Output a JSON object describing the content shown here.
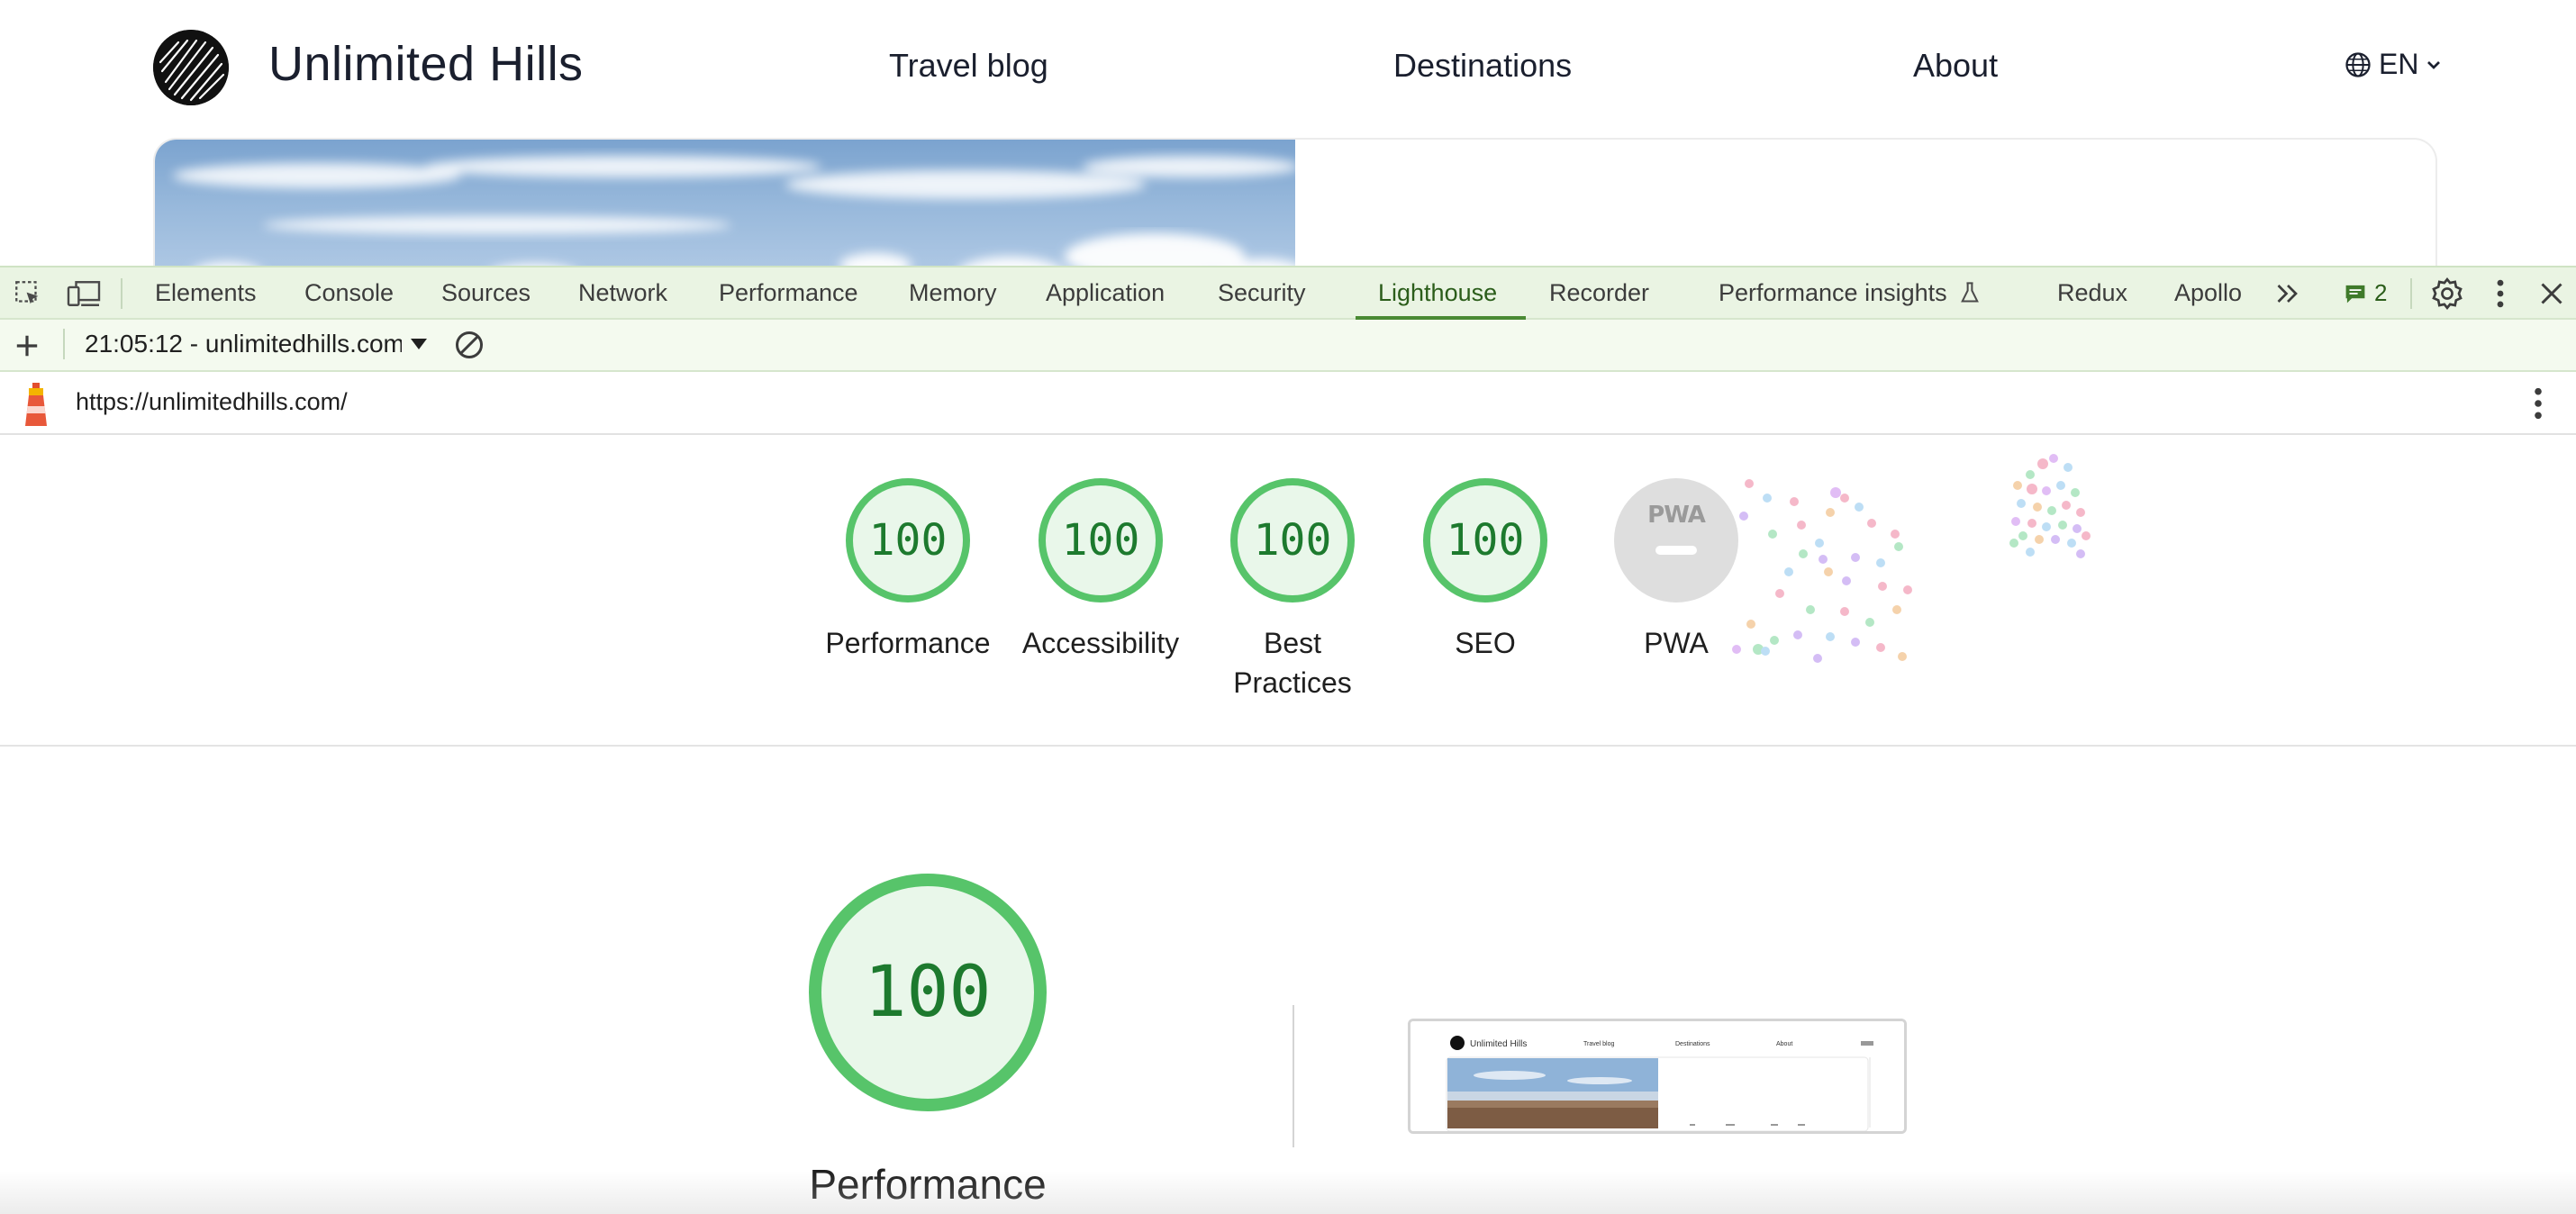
{
  "site": {
    "title": "Unlimited Hills",
    "nav": [
      "Travel blog",
      "Destinations",
      "About"
    ],
    "language": "EN",
    "hero_image": "clouds-sky-photo"
  },
  "devtools": {
    "tabs": [
      "Elements",
      "Console",
      "Sources",
      "Network",
      "Performance",
      "Memory",
      "Application",
      "Security",
      "Lighthouse",
      "Recorder",
      "Performance insights",
      "Redux",
      "Apollo"
    ],
    "active_tab": "Lighthouse",
    "more_tabs_icon": "double-chevron-right-icon",
    "issues_count": "2",
    "icons": [
      "inspect-element-icon",
      "device-toolbar-icon",
      "issues-icon",
      "gear-icon",
      "kebab-menu-icon",
      "close-icon"
    ],
    "accent_color": "#4a8a33",
    "toolbar_bg": "#eaf4e3"
  },
  "lighthouse": {
    "report_select": "21:05:12 - unlimitedhills.com",
    "url": "https://unlimitedhills.com/",
    "scores": [
      {
        "label": "Performance",
        "value": "100"
      },
      {
        "label": "Accessibility",
        "value": "100"
      },
      {
        "label": "Best",
        "label2": "Practices",
        "value": "100"
      },
      {
        "label": "SEO",
        "value": "100"
      }
    ],
    "pwa": {
      "label": "PWA",
      "badge": "PWA"
    },
    "main_score": {
      "label": "Performance",
      "value": "100"
    },
    "pass_color": "#57c46a",
    "thumbnail": {
      "title": "Unlimited Hills",
      "nav": [
        "Travel blog",
        "Destinations",
        "About"
      ]
    }
  }
}
